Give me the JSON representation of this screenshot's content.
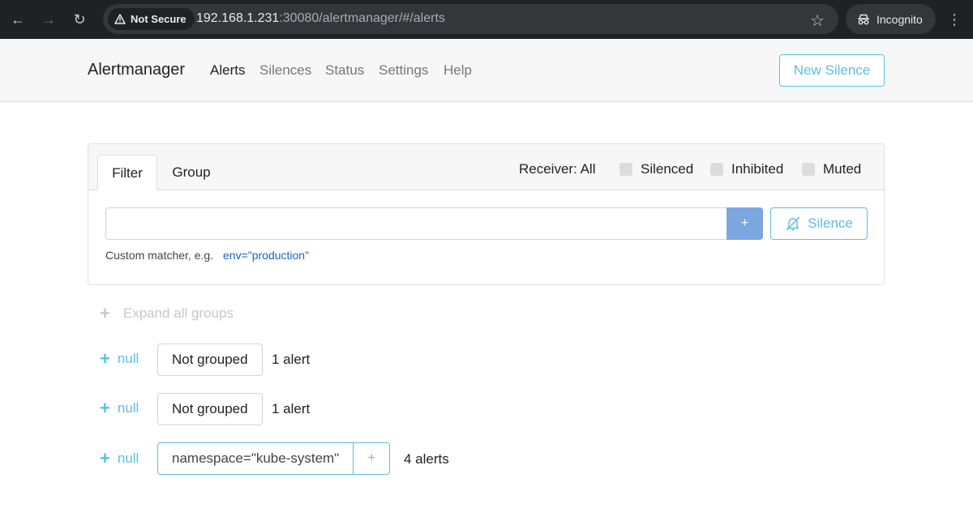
{
  "browser": {
    "security_label": "Not Secure",
    "url_host": "192.168.1.231",
    "url_path": ":30080/alertmanager/#/alerts",
    "profile_label": "Incognito",
    "icons": [
      "back-icon",
      "forward-icon",
      "reload-icon",
      "warning-icon",
      "star-icon",
      "incognito-icon",
      "more-icon"
    ]
  },
  "navbar": {
    "brand": "Alertmanager",
    "links": [
      "Alerts",
      "Silences",
      "Status",
      "Settings",
      "Help"
    ],
    "active": "Alerts",
    "new_silence_label": "New Silence"
  },
  "filter_card": {
    "tabs": [
      "Filter",
      "Group"
    ],
    "active_tab": "Filter",
    "receiver_label": "Receiver: All",
    "checkboxes": [
      {
        "label": "Silenced",
        "checked": false
      },
      {
        "label": "Inhibited",
        "checked": false
      },
      {
        "label": "Muted",
        "checked": false
      }
    ],
    "matcher_value": "",
    "add_button_label": "+",
    "silence_button_label": "Silence",
    "hint_text": "Custom matcher, e.g.",
    "hint_example": "env=\"production\""
  },
  "groups": {
    "expand_all_label": "Expand all groups",
    "items": [
      {
        "toggle_label": "null",
        "group_label": "Not grouped",
        "count": "1 alert"
      },
      {
        "toggle_label": "null",
        "group_label": "Not grouped",
        "count": "1 alert"
      },
      {
        "toggle_label": "null",
        "group_label": "namespace=\"kube-system\"",
        "add_label": "+",
        "count": "4 alerts"
      }
    ]
  },
  "colors": {
    "accent": "#5bc0de",
    "primary_button": "#7ba7e0",
    "link_blue": "#1a63c6"
  }
}
